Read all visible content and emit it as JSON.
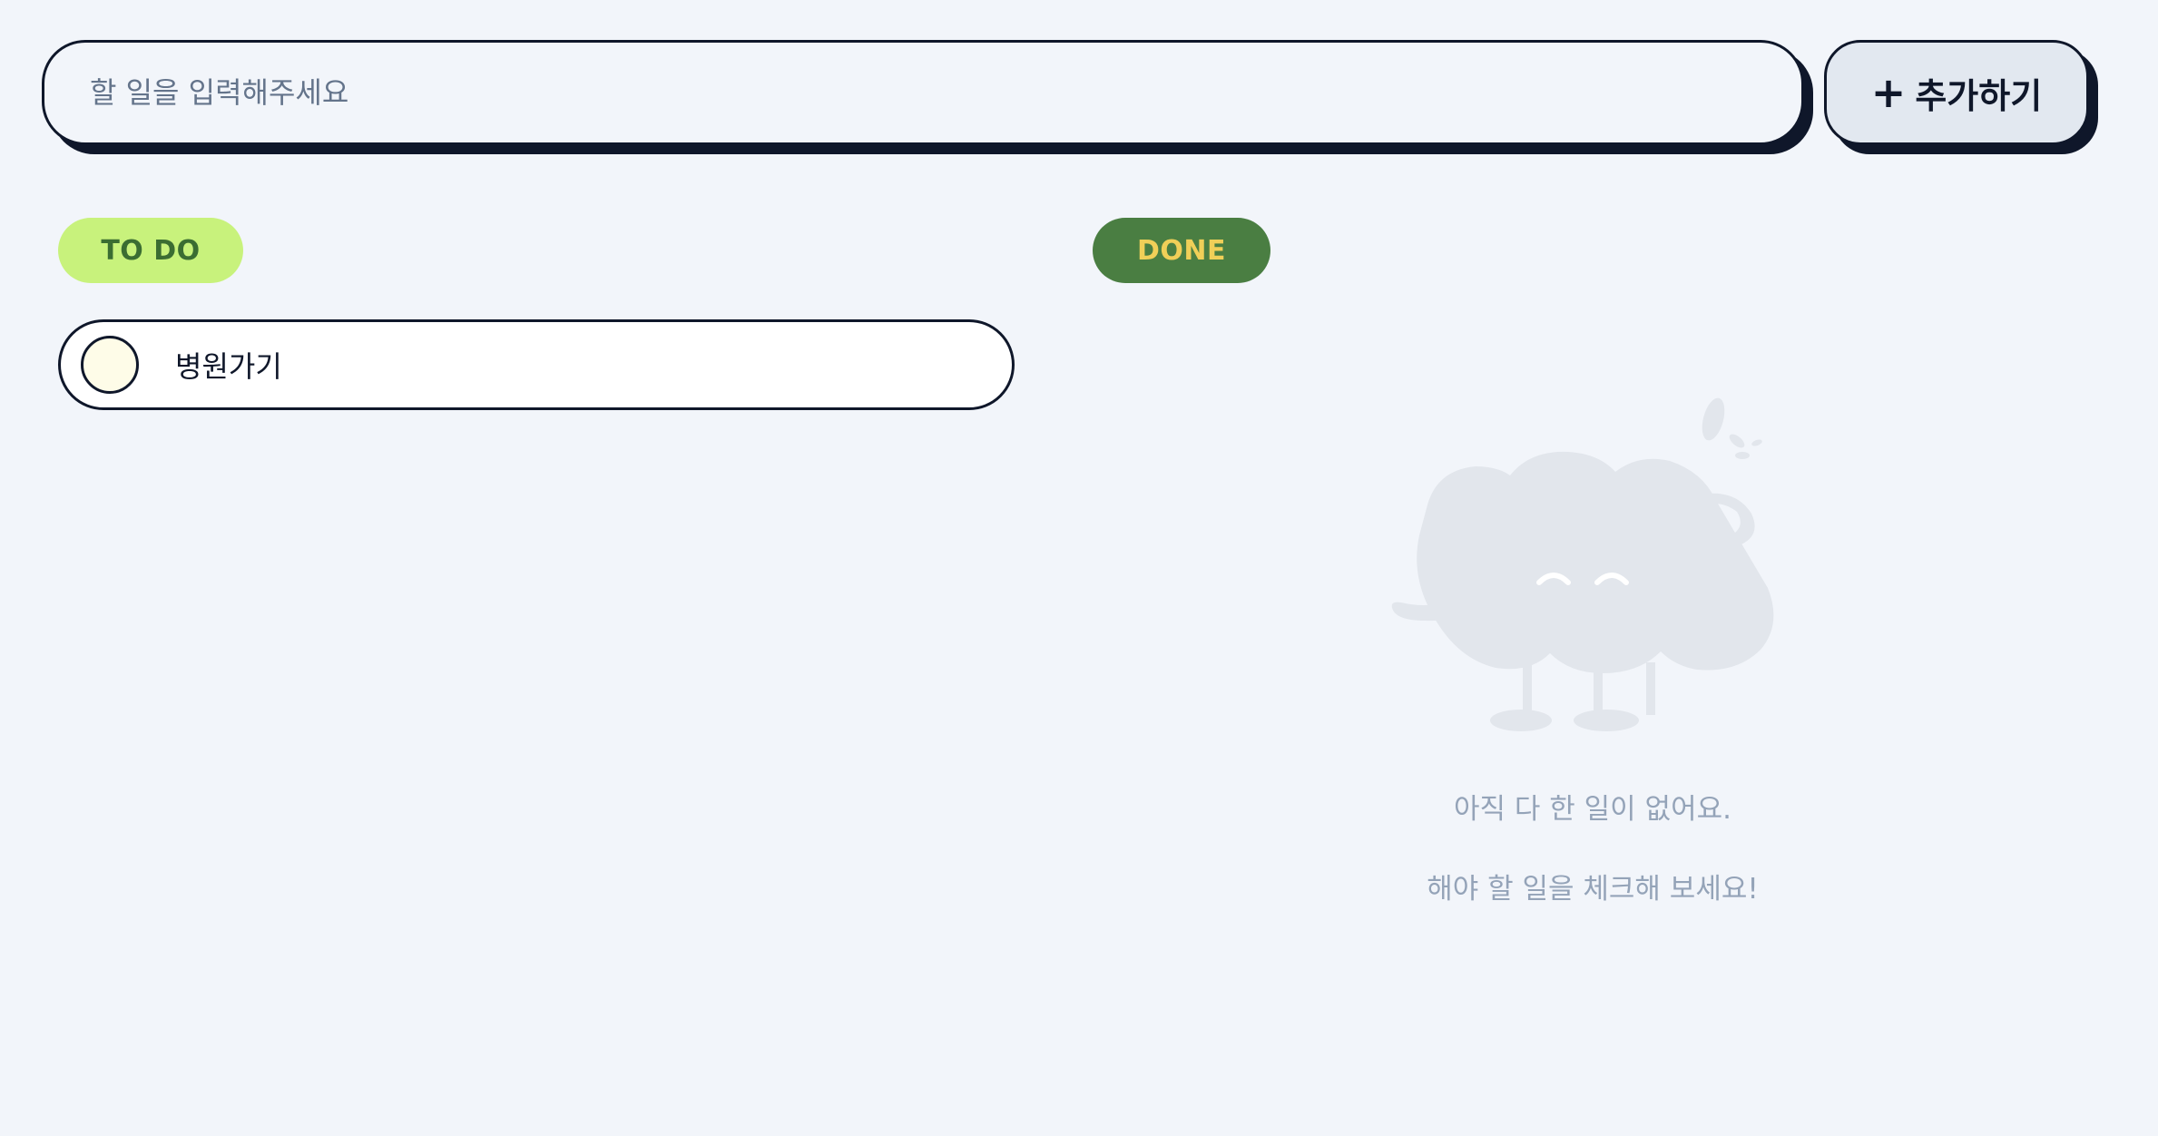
{
  "input": {
    "placeholder": "할 일을 입력해주세요",
    "value": ""
  },
  "add_button": {
    "icon": "plus-icon",
    "icon_glyph": "+",
    "label": "추가하기"
  },
  "sections": {
    "todo": {
      "label": "TO DO",
      "items": [
        {
          "text": "병원가기",
          "checked": false
        }
      ]
    },
    "done": {
      "label": "DONE",
      "items": [],
      "empty_state": {
        "illustration": "empty-mascot-illustration",
        "line1": "아직 다 한 일이 없어요.",
        "line2": "해야 할 일을 체크해 보세요!"
      }
    }
  },
  "colors": {
    "background": "#f2f5fa",
    "border": "#0f172a",
    "todo_badge_bg": "#c8f27c",
    "todo_badge_text": "#3b6d32",
    "done_badge_bg": "#4a7e42",
    "done_badge_text": "#f0cf58",
    "checkbox_fill": "#fefce8",
    "muted_text": "#94a3b8",
    "illustration": "#e2e6ec"
  }
}
